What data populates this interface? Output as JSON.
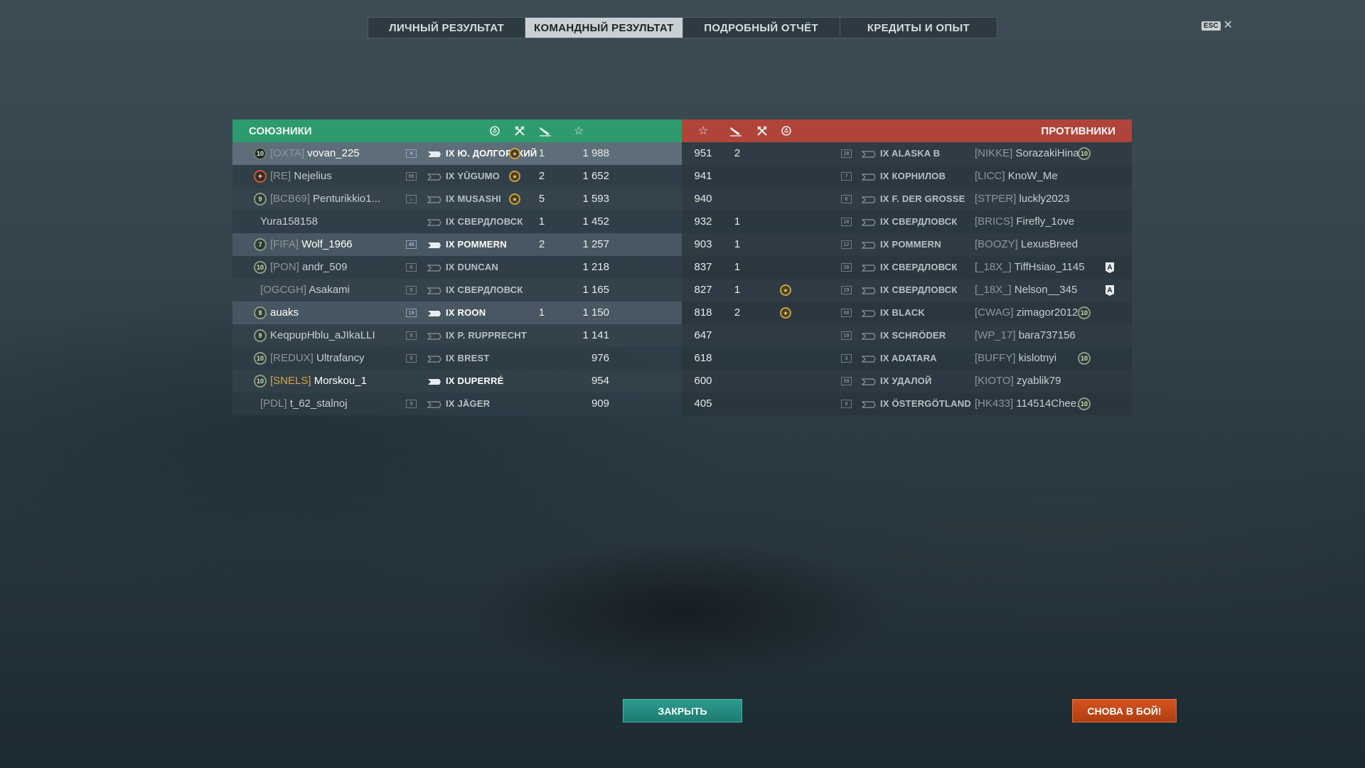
{
  "tabs": [
    {
      "label": "ЛИЧНЫЙ РЕЗУЛЬТАТ",
      "active": false
    },
    {
      "label": "КОМАНДНЫЙ РЕЗУЛЬТАТ",
      "active": true
    },
    {
      "label": "ПОДРОБНЫЙ ОТЧЁТ",
      "active": false
    },
    {
      "label": "КРЕДИТЫ И ОПЫТ",
      "active": false
    }
  ],
  "esc": {
    "key": "ESC",
    "close": "✕"
  },
  "allies": {
    "title": "СОЮЗНИКИ",
    "color": "#2e9b6e",
    "players": [
      {
        "level": "10",
        "clan": "[OXTA]",
        "name": "vovan_225",
        "rank": "4",
        "ship": "IX Ю. ДОЛГОРУКИЙ",
        "medal": true,
        "kills": "1",
        "xp": "1 988"
      },
      {
        "level": "",
        "clan": "[RE]",
        "name": "Nejelius",
        "rank": "69",
        "ship": "IX YŪGUMO",
        "medal": true,
        "kills": "2",
        "xp": "1 652"
      },
      {
        "level": "9",
        "clan": "[BCB69]",
        "name": "Penturikkio1...",
        "rank": "",
        "ship": "IX MUSASHI",
        "medal": true,
        "kills": "5",
        "xp": "1 593"
      },
      {
        "level": "",
        "clan": "",
        "name": "Yura158158",
        "rank": "",
        "ship": "IX СВЕРДЛОВСК",
        "medal": false,
        "kills": "1",
        "xp": "1 452"
      },
      {
        "level": "7",
        "clan": "[FIFA]",
        "name": "Wolf_1966",
        "rank": "49",
        "ship": "IX POMMERN",
        "medal": false,
        "kills": "2",
        "xp": "1 257"
      },
      {
        "level": "10",
        "clan": "[PON]",
        "name": "andr_509",
        "rank": "6",
        "ship": "IX DUNCAN",
        "medal": false,
        "kills": "",
        "xp": "1 218"
      },
      {
        "level": "",
        "clan": "[OGCGH]",
        "name": "Asakami",
        "rank": "9",
        "ship": "IX СВЕРДЛОВСК",
        "medal": false,
        "kills": "",
        "xp": "1 165"
      },
      {
        "level": "8",
        "clan": "",
        "name": "auaks",
        "rank": "19",
        "ship": "IX ROON",
        "medal": false,
        "kills": "1",
        "xp": "1 150"
      },
      {
        "level": "9",
        "clan": "",
        "name": "KeqpupHblu_aJIkaLLI",
        "rank": "9",
        "ship": "IX P. RUPPRECHT",
        "medal": false,
        "kills": "",
        "xp": "1 141"
      },
      {
        "level": "10",
        "clan": "[REDUX]",
        "name": "Ultrafancy",
        "rank": "9",
        "ship": "IX BREST",
        "medal": false,
        "kills": "",
        "xp": "976"
      },
      {
        "level": "10",
        "clan": "[SNELS]",
        "name": "Morskou_1",
        "rank": "",
        "ship": "IX DUPERRÉ",
        "medal": false,
        "kills": "",
        "xp": "954"
      },
      {
        "level": "",
        "clan": "[PDL]",
        "name": "t_62_stalnoj",
        "rank": "9",
        "ship": "IX JÄGER",
        "medal": false,
        "kills": "",
        "xp": "909"
      }
    ]
  },
  "enemies": {
    "title": "ПРОТИВНИКИ",
    "color": "#b0443a",
    "players": [
      {
        "xp": "951",
        "kills": "2",
        "medal": false,
        "rank": "28",
        "ship": "IX ALASKA B",
        "clan": "[NIKKE]",
        "name": "SorazakiHina",
        "level": "10",
        "badge": ""
      },
      {
        "xp": "941",
        "kills": "",
        "medal": false,
        "rank": "7",
        "ship": "IX КОРНИЛОВ",
        "clan": "[LICC]",
        "name": "KnoW_Me",
        "level": "",
        "badge": ""
      },
      {
        "xp": "940",
        "kills": "",
        "medal": false,
        "rank": "6",
        "ship": "IX F. DER GROSSE",
        "clan": "[STPER]",
        "name": "luckly2023",
        "level": "",
        "badge": ""
      },
      {
        "xp": "932",
        "kills": "1",
        "medal": false,
        "rank": "28",
        "ship": "IX СВЕРДЛОВСК",
        "clan": "[BRICS]",
        "name": "Firefly_1ove",
        "level": "",
        "badge": ""
      },
      {
        "xp": "903",
        "kills": "1",
        "medal": false,
        "rank": "12",
        "ship": "IX POMMERN",
        "clan": "[BOOZY]",
        "name": "LexusBreed",
        "level": "",
        "badge": ""
      },
      {
        "xp": "837",
        "kills": "1",
        "medal": false,
        "rank": "28",
        "ship": "IX СВЕРДЛОВСК",
        "clan": "[_18X_]",
        "name": "TiffHsiao_1145",
        "level": "",
        "badge": "A"
      },
      {
        "xp": "827",
        "kills": "1",
        "medal": true,
        "rank": "19",
        "ship": "IX СВЕРДЛОВСК",
        "clan": "[_18X_]",
        "name": "Nelson__345",
        "level": "",
        "badge": "A"
      },
      {
        "xp": "818",
        "kills": "2",
        "medal": true,
        "rank": "68",
        "ship": "IX BLACK",
        "clan": "[CWAG]",
        "name": "zimagor2012",
        "level": "10",
        "badge": ""
      },
      {
        "xp": "647",
        "kills": "",
        "medal": false,
        "rank": "19",
        "ship": "IX SCHRÖDER",
        "clan": "[WP_17]",
        "name": "bara737156",
        "level": "",
        "badge": ""
      },
      {
        "xp": "618",
        "kills": "",
        "medal": false,
        "rank": "3",
        "ship": "IX ADATARA",
        "clan": "[BUFFY]",
        "name": "kislotnyi",
        "level": "10",
        "badge": ""
      },
      {
        "xp": "600",
        "kills": "",
        "medal": false,
        "rank": "59",
        "ship": "IX УДАЛОЙ",
        "clan": "[KIOTO]",
        "name": "zyablik79",
        "level": "",
        "badge": ""
      },
      {
        "xp": "405",
        "kills": "",
        "medal": false,
        "rank": "9",
        "ship": "IX ÖSTERGÖTLAND",
        "clan": "[HK433]",
        "name": "114514Chee...",
        "level": "10",
        "badge": ""
      }
    ]
  },
  "columns": {
    "medal_icon": "laurel-icon",
    "planes_icon": "crossed-planes-icon",
    "ships_icon": "sinking-ship-icon",
    "xp_icon": "star-icon"
  },
  "buttons": {
    "close": "ЗАКРЫТЬ",
    "again": "СНОВА В БОЙ!"
  }
}
